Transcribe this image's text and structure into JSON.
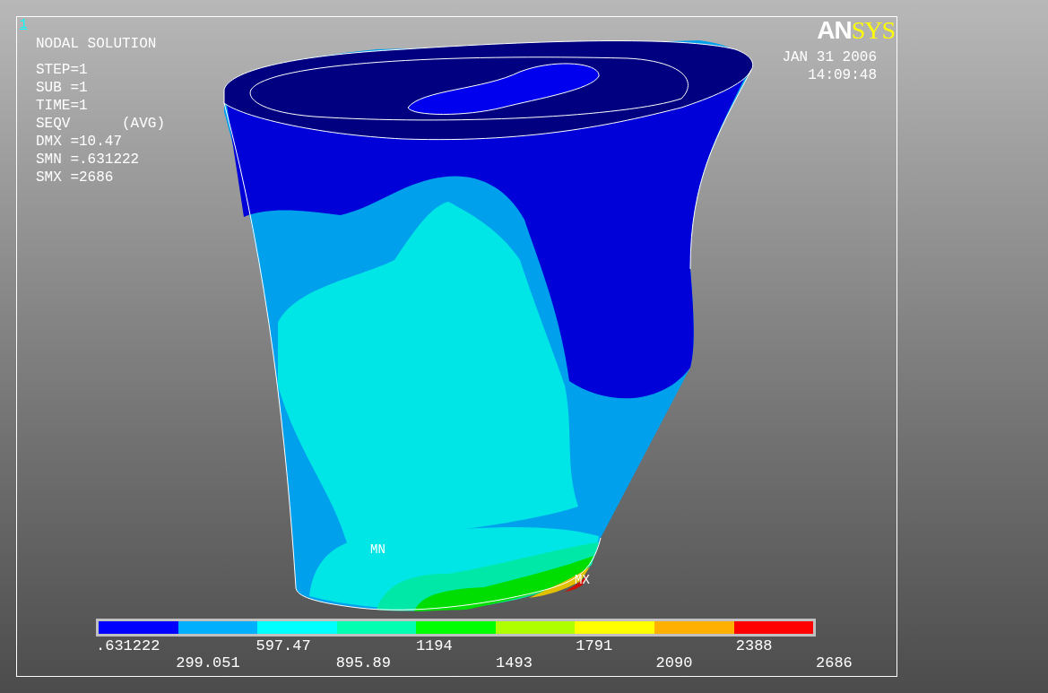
{
  "window_number": "1",
  "title": "NODAL SOLUTION",
  "info_lines": [
    "STEP=1",
    "SUB =1",
    "TIME=1",
    "SEQV      (AVG)",
    "DMX =10.47",
    "SMN =.631222",
    "SMX =2686"
  ],
  "logo": {
    "part1": "AN",
    "part2": "SYS"
  },
  "date": "JAN 31 2006",
  "time": "14:09:48",
  "markers": [
    {
      "kind": "min",
      "label": "MN"
    },
    {
      "kind": "max",
      "label": "MX"
    }
  ],
  "legend": {
    "bands": [
      {
        "color": "#0000ff"
      },
      {
        "color": "#00b0ff"
      },
      {
        "color": "#00ffff"
      },
      {
        "color": "#00ffb0"
      },
      {
        "color": "#00ff00"
      },
      {
        "color": "#b0ff00"
      },
      {
        "color": "#ffff00"
      },
      {
        "color": "#ffb000"
      },
      {
        "color": "#ff0000"
      }
    ],
    "labels": [
      ".631222",
      "299.051",
      "597.47",
      "895.89",
      "1194",
      "1493",
      "1791",
      "2090",
      "2388",
      "2686"
    ]
  }
}
